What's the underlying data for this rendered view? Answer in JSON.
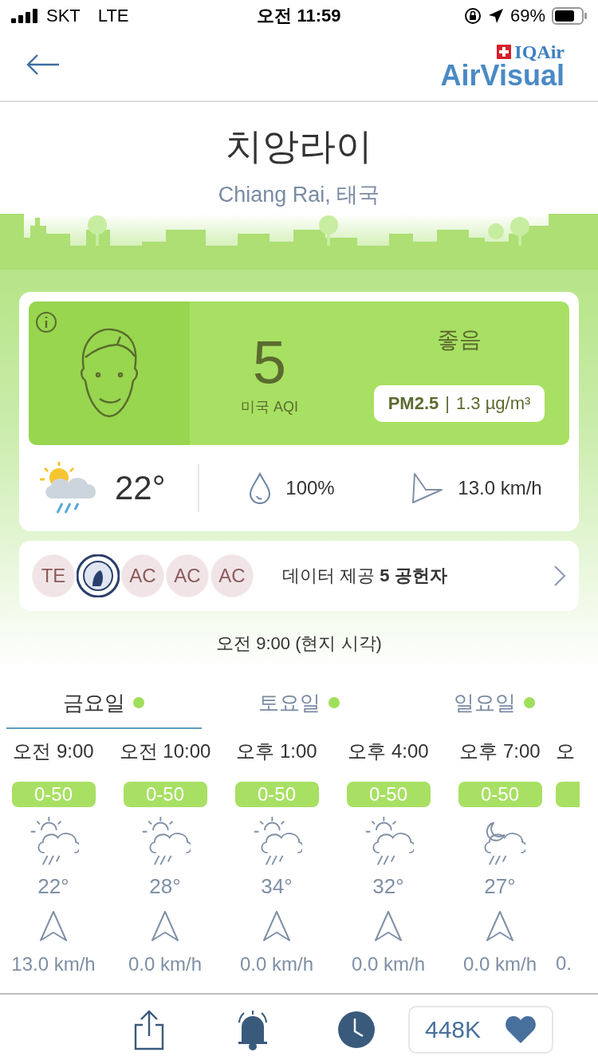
{
  "status_bar": {
    "carrier": "SKT",
    "network": "LTE",
    "time": "오전 11:59",
    "battery": "69%"
  },
  "header": {
    "brand_top": "IQAir",
    "brand": "AirVisual"
  },
  "city": {
    "name": "치앙라이",
    "subtitle": "Chiang Rai, 태국"
  },
  "aqi": {
    "value": "5",
    "unit": "미국 AQI",
    "status": "좋음",
    "pollutant": "PM2.5",
    "separator": "|",
    "concentration": "1.3 µg/m³"
  },
  "weather": {
    "temperature": "22°",
    "humidity": "100%",
    "wind": "13.0 km/h"
  },
  "contributors": {
    "avatars": [
      {
        "kind": "text",
        "label": "TE"
      },
      {
        "kind": "logo"
      },
      {
        "kind": "text",
        "label": "AC"
      },
      {
        "kind": "text",
        "label": "AC"
      },
      {
        "kind": "text",
        "label": "AC"
      }
    ],
    "text": "데이터 제공 **5 공헌자**"
  },
  "local_time": "오전 9:00 (현지 시각)",
  "tabs": [
    {
      "label": "금요일",
      "selected": true
    },
    {
      "label": "토요일",
      "selected": false
    },
    {
      "label": "일요일",
      "selected": false
    }
  ],
  "forecast": [
    {
      "time": "오전 9:00",
      "aqi": "0-50",
      "kind": "day-rain",
      "temp": "22°",
      "wind": "13.0 km/h"
    },
    {
      "time": "오전 10:00",
      "aqi": "0-50",
      "kind": "day-rain",
      "temp": "28°",
      "wind": "0.0 km/h"
    },
    {
      "time": "오후 1:00",
      "aqi": "0-50",
      "kind": "day-rain",
      "temp": "34°",
      "wind": "0.0 km/h"
    },
    {
      "time": "오후 4:00",
      "aqi": "0-50",
      "kind": "day-rain",
      "temp": "32°",
      "wind": "0.0 km/h"
    },
    {
      "time": "오후 7:00",
      "aqi": "0-50",
      "kind": "night-rain",
      "temp": "27°",
      "wind": "0.0 km/h"
    },
    {
      "time": "오",
      "kind": "partial",
      "wind": "0."
    }
  ],
  "bottom_bar": {
    "likes": "448K"
  }
}
